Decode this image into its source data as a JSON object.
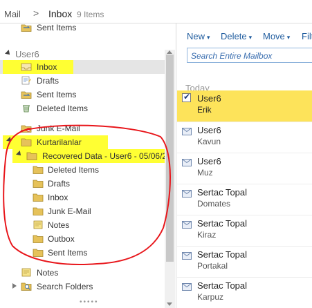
{
  "breadcrumb": {
    "root": "Mail",
    "separator": ">",
    "folder": "Inbox",
    "count": "9 Items"
  },
  "account": {
    "name": "User6"
  },
  "folders": {
    "sent_items_top": "Sent Items",
    "inbox": "Inbox",
    "drafts": "Drafts",
    "sent_items": "Sent Items",
    "deleted_items": "Deleted Items",
    "junk_email": "Junk E-Mail",
    "kurtarilanlar": "Kurtarilanlar",
    "recovered_data": "Recovered Data - User6 - 05/06/20",
    "sub_deleted_items": "Deleted Items",
    "sub_drafts": "Drafts",
    "sub_inbox": "Inbox",
    "sub_junk_email": "Junk E-Mail",
    "sub_notes": "Notes",
    "sub_outbox": "Outbox",
    "sub_sent_items": "Sent Items",
    "notes": "Notes",
    "search_folders": "Search Folders"
  },
  "toolbar": {
    "new": "New",
    "delete": "Delete",
    "move": "Move",
    "filter": "Filt"
  },
  "search": {
    "placeholder": "Search Entire Mailbox"
  },
  "list": {
    "group": "Today",
    "messages": [
      {
        "from": "User6",
        "subject": "Erik"
      },
      {
        "from": "User6",
        "subject": "Kavun"
      },
      {
        "from": "User6",
        "subject": "Muz"
      },
      {
        "from": "Sertac Topal",
        "subject": "Domates"
      },
      {
        "from": "Sertac Topal",
        "subject": "Kiraz"
      },
      {
        "from": "Sertac Topal",
        "subject": "Portakal"
      },
      {
        "from": "Sertac Topal",
        "subject": "Karpuz"
      }
    ]
  },
  "colors": {
    "highlight": "#ffff33",
    "selected_message": "#fde35a",
    "link": "#1e5b9e",
    "annotation": "#e8161b"
  }
}
